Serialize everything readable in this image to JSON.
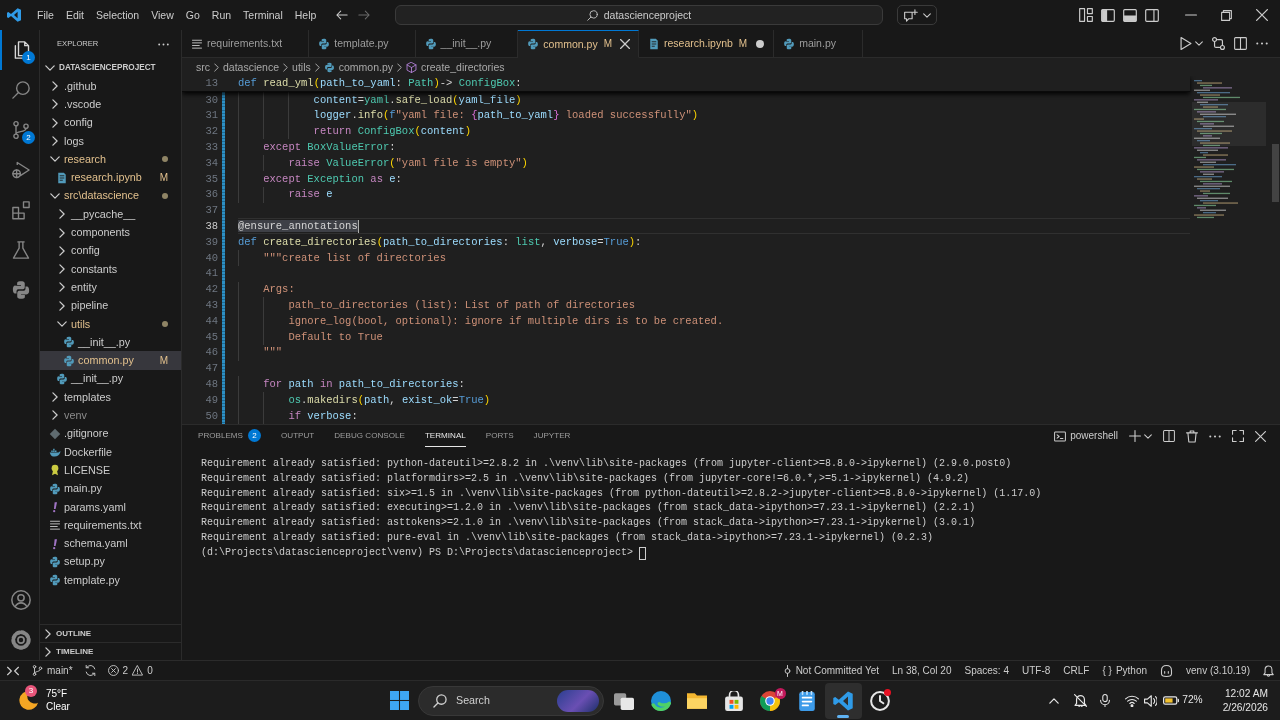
{
  "title_bar": {
    "menu": [
      "File",
      "Edit",
      "Selection",
      "View",
      "Go",
      "Run",
      "Terminal",
      "Help"
    ],
    "command_center": "datascienceproject"
  },
  "activity_bar": {
    "items": [
      {
        "kind": "explorer",
        "selected": true,
        "badge": "1"
      },
      {
        "kind": "search",
        "selected": false
      },
      {
        "kind": "source-control",
        "selected": false,
        "badge": "2"
      },
      {
        "kind": "debug",
        "selected": false
      },
      {
        "kind": "extensions",
        "selected": false
      },
      {
        "kind": "testing",
        "selected": false
      },
      {
        "kind": "python",
        "selected": false
      }
    ]
  },
  "sidebar": {
    "title": "EXPLORER",
    "root": {
      "label": "DATASCIENCEPROJECT",
      "expanded": true
    },
    "items": [
      {
        "label": ".github",
        "kind": "folder",
        "expanded": false,
        "selected": false,
        "modified": false,
        "ignored": false
      },
      {
        "label": ".vscode",
        "kind": "folder",
        "expanded": false,
        "selected": false,
        "modified": false,
        "ignored": false
      },
      {
        "label": "config",
        "kind": "folder",
        "expanded": false,
        "selected": false,
        "modified": false,
        "ignored": false
      },
      {
        "label": "logs",
        "kind": "folder",
        "expanded": false,
        "selected": false,
        "modified": false,
        "ignored": false
      },
      {
        "label": "research",
        "kind": "folder",
        "expanded": true,
        "selected": false,
        "modified": true,
        "ignored": false,
        "children": [
          {
            "label": "research.ipynb",
            "kind": "notebook",
            "selected": false,
            "modified": true,
            "ignored": false,
            "badge": "M"
          }
        ]
      },
      {
        "label": "src\\datascience",
        "kind": "folder",
        "expanded": true,
        "selected": false,
        "modified": true,
        "ignored": false,
        "children": [
          {
            "label": "__pycache__",
            "kind": "folder",
            "expanded": false,
            "selected": false,
            "modified": false,
            "ignored": false
          },
          {
            "label": "components",
            "kind": "folder",
            "expanded": false,
            "selected": false,
            "modified": false,
            "ignored": false
          },
          {
            "label": "config",
            "kind": "folder",
            "expanded": false,
            "selected": false,
            "modified": false,
            "ignored": false
          },
          {
            "label": "constants",
            "kind": "folder",
            "expanded": false,
            "selected": false,
            "modified": false,
            "ignored": false
          },
          {
            "label": "entity",
            "kind": "folder",
            "expanded": false,
            "selected": false,
            "modified": false,
            "ignored": false
          },
          {
            "label": "pipeline",
            "kind": "folder",
            "expanded": false,
            "selected": false,
            "modified": false,
            "ignored": false
          },
          {
            "label": "utils",
            "kind": "folder",
            "expanded": true,
            "selected": false,
            "modified": true,
            "ignored": false,
            "children": [
              {
                "label": "__init__.py",
                "kind": "python",
                "selected": false,
                "modified": false,
                "ignored": false
              },
              {
                "label": "common.py",
                "kind": "python",
                "selected": true,
                "modified": true,
                "ignored": false,
                "badge": "M"
              }
            ]
          },
          {
            "label": "__init__.py",
            "kind": "python",
            "selected": false,
            "modified": false,
            "ignored": false
          }
        ]
      },
      {
        "label": "templates",
        "kind": "folder",
        "expanded": false,
        "selected": false,
        "modified": false,
        "ignored": false
      },
      {
        "label": "venv",
        "kind": "folder",
        "expanded": false,
        "selected": false,
        "modified": false,
        "ignored": true
      },
      {
        "label": ".gitignore",
        "kind": "gitignore",
        "selected": false,
        "modified": false,
        "ignored": false
      },
      {
        "label": "Dockerfile",
        "kind": "docker",
        "selected": false,
        "modified": false,
        "ignored": false
      },
      {
        "label": "LICENSE",
        "kind": "license",
        "selected": false,
        "modified": false,
        "ignored": false
      },
      {
        "label": "main.py",
        "kind": "python",
        "selected": false,
        "modified": false,
        "ignored": false
      },
      {
        "label": "params.yaml",
        "kind": "yaml",
        "selected": false,
        "modified": false,
        "ignored": false
      },
      {
        "label": "requirements.txt",
        "kind": "text",
        "selected": false,
        "modified": false,
        "ignored": false
      },
      {
        "label": "schema.yaml",
        "kind": "yaml",
        "selected": false,
        "modified": false,
        "ignored": false
      },
      {
        "label": "setup.py",
        "kind": "python",
        "selected": false,
        "modified": false,
        "ignored": false
      },
      {
        "label": "template.py",
        "kind": "python",
        "selected": false,
        "modified": false,
        "ignored": false
      }
    ],
    "sections": [
      {
        "label": "OUTLINE",
        "expanded": false
      },
      {
        "label": "TIMELINE",
        "expanded": false
      }
    ]
  },
  "editor": {
    "tabs": [
      {
        "label": "requirements.txt",
        "kind": "text",
        "selected": false,
        "modified": false,
        "dirty": false
      },
      {
        "label": "template.py",
        "kind": "python",
        "selected": false,
        "modified": false,
        "dirty": false
      },
      {
        "label": "__init__.py",
        "kind": "python",
        "selected": false,
        "modified": false,
        "dirty": false
      },
      {
        "label": "common.py",
        "kind": "python",
        "selected": true,
        "modified": true,
        "dirty": false,
        "badge": "M"
      },
      {
        "label": "research.ipynb",
        "kind": "notebook",
        "selected": false,
        "modified": true,
        "dirty": true,
        "badge": "M"
      },
      {
        "label": "main.py",
        "kind": "python",
        "selected": false,
        "modified": false,
        "dirty": false
      }
    ],
    "breadcrumbs": [
      {
        "label": "src",
        "kind": "folder"
      },
      {
        "label": "datascience",
        "kind": "folder"
      },
      {
        "label": "utils",
        "kind": "folder"
      },
      {
        "label": "common.py",
        "kind": "python"
      },
      {
        "label": "create_directories",
        "kind": "symbol"
      }
    ],
    "lines": [
      {
        "number": "13",
        "sticky": true,
        "current": false,
        "changed": false,
        "tokens": [
          {
            "text": "def ",
            "kind": "keyword"
          },
          {
            "text": "read_yml",
            "kind": "function"
          },
          {
            "text": "(",
            "kind": "bracket"
          },
          {
            "text": "path_to_yaml",
            "kind": "variable"
          },
          {
            "text": ": ",
            "kind": "plain"
          },
          {
            "text": "Path",
            "kind": "type"
          },
          {
            "text": ")",
            "kind": "bracket"
          },
          {
            "text": "-> ",
            "kind": "plain"
          },
          {
            "text": "ConfigBox",
            "kind": "type"
          },
          {
            "text": ":",
            "kind": "plain"
          }
        ]
      },
      {
        "number": "30",
        "sticky": false,
        "current": false,
        "changed": true,
        "tokens": [
          {
            "text": "            content",
            "kind": "variable"
          },
          {
            "text": "=",
            "kind": "plain"
          },
          {
            "text": "yaml",
            "kind": "type"
          },
          {
            "text": ".",
            "kind": "plain"
          },
          {
            "text": "safe_load",
            "kind": "function"
          },
          {
            "text": "(",
            "kind": "bracket"
          },
          {
            "text": "yaml_file",
            "kind": "variable"
          },
          {
            "text": ")",
            "kind": "bracket"
          }
        ]
      },
      {
        "number": "31",
        "sticky": false,
        "current": false,
        "changed": true,
        "tokens": [
          {
            "text": "            logger",
            "kind": "variable"
          },
          {
            "text": ".",
            "kind": "plain"
          },
          {
            "text": "info",
            "kind": "function"
          },
          {
            "text": "(",
            "kind": "bracket"
          },
          {
            "text": "f",
            "kind": "keyword"
          },
          {
            "text": "\"yaml file: ",
            "kind": "string"
          },
          {
            "text": "{",
            "kind": "brace"
          },
          {
            "text": "path_to_yaml",
            "kind": "variable"
          },
          {
            "text": "}",
            "kind": "brace"
          },
          {
            "text": " loaded successfully\"",
            "kind": "string"
          },
          {
            "text": ")",
            "kind": "bracket"
          }
        ]
      },
      {
        "number": "32",
        "sticky": false,
        "current": false,
        "changed": true,
        "tokens": [
          {
            "text": "            return ",
            "kind": "control"
          },
          {
            "text": "ConfigBox",
            "kind": "type"
          },
          {
            "text": "(",
            "kind": "bracket"
          },
          {
            "text": "content",
            "kind": "variable"
          },
          {
            "text": ")",
            "kind": "bracket"
          }
        ]
      },
      {
        "number": "33",
        "sticky": false,
        "current": false,
        "changed": true,
        "tokens": [
          {
            "text": "    except ",
            "kind": "control"
          },
          {
            "text": "BoxValueError",
            "kind": "type"
          },
          {
            "text": ":",
            "kind": "plain"
          }
        ]
      },
      {
        "number": "34",
        "sticky": false,
        "current": false,
        "changed": true,
        "tokens": [
          {
            "text": "        raise ",
            "kind": "control"
          },
          {
            "text": "ValueError",
            "kind": "type"
          },
          {
            "text": "(",
            "kind": "bracket"
          },
          {
            "text": "\"yaml file is empty\"",
            "kind": "string"
          },
          {
            "text": ")",
            "kind": "bracket"
          }
        ]
      },
      {
        "number": "35",
        "sticky": false,
        "current": false,
        "changed": true,
        "tokens": [
          {
            "text": "    except ",
            "kind": "control"
          },
          {
            "text": "Exception",
            "kind": "type"
          },
          {
            "text": " as ",
            "kind": "control"
          },
          {
            "text": "e",
            "kind": "variable"
          },
          {
            "text": ":",
            "kind": "plain"
          }
        ]
      },
      {
        "number": "36",
        "sticky": false,
        "current": false,
        "changed": true,
        "tokens": [
          {
            "text": "        raise ",
            "kind": "control"
          },
          {
            "text": "e",
            "kind": "variable"
          }
        ]
      },
      {
        "number": "37",
        "sticky": false,
        "current": false,
        "changed": true
      },
      {
        "number": "38",
        "sticky": false,
        "current": true,
        "changed": true,
        "tokens": [
          {
            "text": "@ensure_annotations",
            "kind": "selection"
          }
        ]
      },
      {
        "number": "39",
        "sticky": false,
        "current": false,
        "changed": true,
        "tokens": [
          {
            "text": "def ",
            "kind": "keyword"
          },
          {
            "text": "create_directories",
            "kind": "function"
          },
          {
            "text": "(",
            "kind": "bracket"
          },
          {
            "text": "path_to_directories",
            "kind": "variable"
          },
          {
            "text": ": ",
            "kind": "plain"
          },
          {
            "text": "list",
            "kind": "type"
          },
          {
            "text": ", ",
            "kind": "plain"
          },
          {
            "text": "verbose",
            "kind": "variable"
          },
          {
            "text": "=",
            "kind": "plain"
          },
          {
            "text": "True",
            "kind": "keyword"
          },
          {
            "text": ")",
            "kind": "bracket"
          },
          {
            "text": ":",
            "kind": "plain"
          }
        ]
      },
      {
        "number": "40",
        "sticky": false,
        "current": false,
        "changed": true,
        "tokens": [
          {
            "text": "    \"\"\"create list of directories",
            "kind": "string"
          }
        ]
      },
      {
        "number": "41",
        "sticky": false,
        "current": false,
        "changed": true
      },
      {
        "number": "42",
        "sticky": false,
        "current": false,
        "changed": true,
        "tokens": [
          {
            "text": "    Args:",
            "kind": "string"
          }
        ]
      },
      {
        "number": "43",
        "sticky": false,
        "current": false,
        "changed": true,
        "tokens": [
          {
            "text": "        path_to_directories (list): List of path of directories",
            "kind": "string"
          }
        ]
      },
      {
        "number": "44",
        "sticky": false,
        "current": false,
        "changed": true,
        "tokens": [
          {
            "text": "        ignore_log(bool, optional): ignore if multiple dirs is to be created.",
            "kind": "string"
          }
        ]
      },
      {
        "number": "45",
        "sticky": false,
        "current": false,
        "changed": true,
        "tokens": [
          {
            "text": "        Default to True",
            "kind": "string"
          }
        ]
      },
      {
        "number": "46",
        "sticky": false,
        "current": false,
        "changed": true,
        "tokens": [
          {
            "text": "    \"\"\"",
            "kind": "string"
          }
        ]
      },
      {
        "number": "47",
        "sticky": false,
        "current": false,
        "changed": true
      },
      {
        "number": "48",
        "sticky": false,
        "current": false,
        "changed": true,
        "tokens": [
          {
            "text": "    for ",
            "kind": "control"
          },
          {
            "text": "path",
            "kind": "variable"
          },
          {
            "text": " in ",
            "kind": "control"
          },
          {
            "text": "path_to_directories",
            "kind": "variable"
          },
          {
            "text": ":",
            "kind": "plain"
          }
        ]
      },
      {
        "number": "49",
        "sticky": false,
        "current": false,
        "changed": true,
        "tokens": [
          {
            "text": "        os",
            "kind": "type"
          },
          {
            "text": ".",
            "kind": "plain"
          },
          {
            "text": "makedirs",
            "kind": "function"
          },
          {
            "text": "(",
            "kind": "bracket"
          },
          {
            "text": "path",
            "kind": "variable"
          },
          {
            "text": ", ",
            "kind": "plain"
          },
          {
            "text": "exist_ok",
            "kind": "variable"
          },
          {
            "text": "=",
            "kind": "plain"
          },
          {
            "text": "True",
            "kind": "keyword"
          },
          {
            "text": ")",
            "kind": "bracket"
          }
        ]
      },
      {
        "number": "50",
        "sticky": false,
        "current": false,
        "changed": true,
        "tokens": [
          {
            "text": "        if ",
            "kind": "control"
          },
          {
            "text": "verbose",
            "kind": "variable"
          },
          {
            "text": ":",
            "kind": "plain"
          }
        ]
      }
    ]
  },
  "panel": {
    "tabs": [
      {
        "label": "PROBLEMS",
        "selected": false,
        "badge": "2"
      },
      {
        "label": "OUTPUT",
        "selected": false
      },
      {
        "label": "DEBUG CONSOLE",
        "selected": false
      },
      {
        "label": "TERMINAL",
        "selected": true
      },
      {
        "label": "PORTS",
        "selected": false
      },
      {
        "label": "JUPYTER",
        "selected": false
      }
    ],
    "shell": "powershell",
    "lines": [
      "Requirement already satisfied: python-dateutil>=2.8.2 in .\\venv\\lib\\site-packages (from jupyter-client>=8.8.0->ipykernel) (2.9.0.post0)",
      "Requirement already satisfied: platformdirs>=2.5 in .\\venv\\lib\\site-packages (from jupyter-core!=6.0.*,>=5.1->ipykernel) (4.9.2)",
      "Requirement already satisfied: six>=1.5 in .\\venv\\lib\\site-packages (from python-dateutil>=2.8.2->jupyter-client>=8.8.0->ipykernel) (1.17.0)",
      "Requirement already satisfied: executing>=1.2.0 in .\\venv\\lib\\site-packages (from stack_data->ipython>=7.23.1->ipykernel) (2.2.1)",
      "Requirement already satisfied: asttokens>=2.1.0 in .\\venv\\lib\\site-packages (from stack_data->ipython>=7.23.1->ipykernel) (3.0.1)",
      "Requirement already satisfied: pure-eval in .\\venv\\lib\\site-packages (from stack_data->ipython>=7.23.1->ipykernel) (0.2.3)"
    ],
    "prompt": "(d:\\Projects\\datascienceproject\\venv) PS D:\\Projects\\datascienceproject>"
  },
  "status_bar": {
    "branch": "main*",
    "errors": "2",
    "warnings": "0",
    "items": [
      {
        "kind": "commit",
        "text": "Not Committed Yet"
      },
      {
        "kind": "text",
        "text": "Ln 38, Col 20"
      },
      {
        "kind": "text",
        "text": "Spaces: 4"
      },
      {
        "kind": "text",
        "text": "UTF-8"
      },
      {
        "kind": "text",
        "text": "CRLF"
      },
      {
        "kind": "language",
        "glyph": "{ }",
        "text": "Python"
      },
      {
        "kind": "copilot"
      },
      {
        "kind": "text",
        "text": "venv (3.10.19)"
      },
      {
        "kind": "bell"
      }
    ]
  },
  "taskbar": {
    "weather": {
      "badge": "3",
      "temperature": "75°F",
      "condition": "Clear"
    },
    "search": "Search",
    "apps": [
      {
        "kind": "task-view",
        "active": false,
        "alert": false
      },
      {
        "kind": "edge",
        "active": false,
        "alert": false
      },
      {
        "kind": "explorer",
        "active": false,
        "alert": false
      },
      {
        "kind": "store",
        "active": false,
        "alert": false
      },
      {
        "kind": "chrome",
        "active": false,
        "alert": false,
        "badge": "M"
      },
      {
        "kind": "notepad",
        "active": false,
        "alert": false
      },
      {
        "kind": "vscode",
        "active": true,
        "alert": false
      },
      {
        "kind": "clock",
        "active": false,
        "alert": true
      }
    ],
    "tray": {
      "battery": "72%",
      "time": "12:02 AM",
      "date": "2/26/2026"
    }
  }
}
